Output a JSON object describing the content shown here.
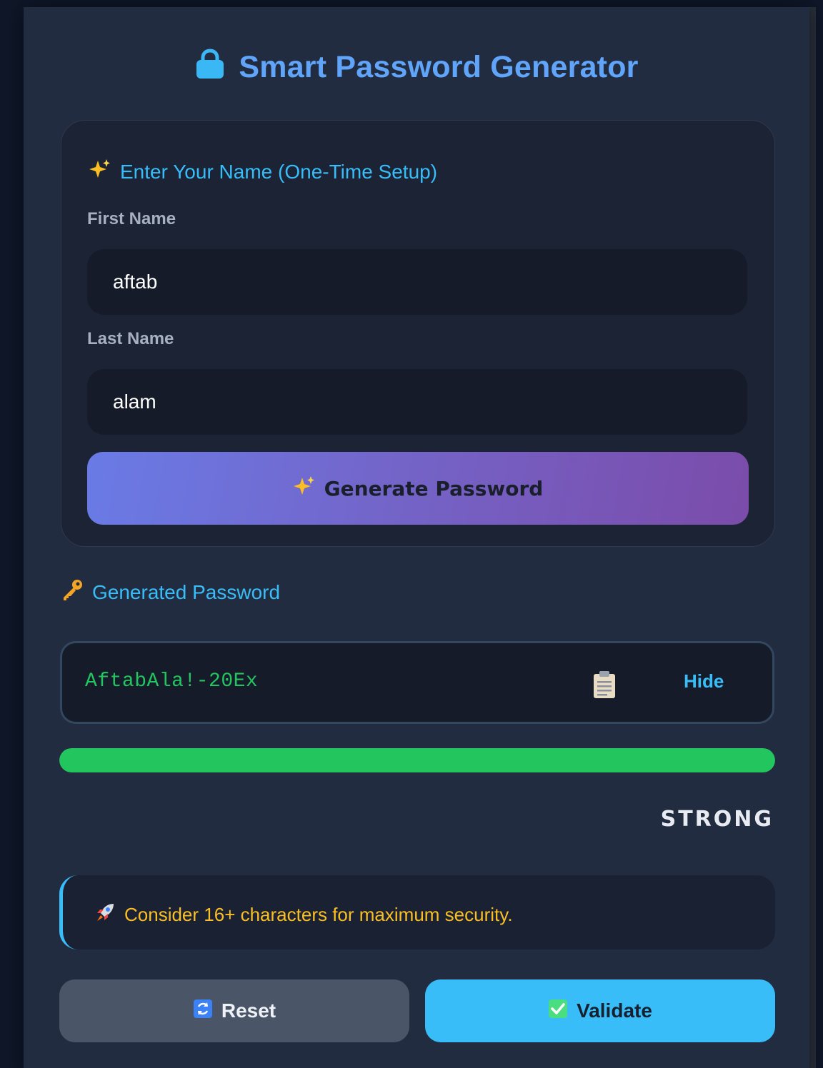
{
  "app": {
    "title": "Smart Password Generator",
    "title_icon": "lock-icon"
  },
  "setup": {
    "heading": "Enter Your Name (One-Time Setup)",
    "heading_icon": "sparkles-icon",
    "first_name_label": "First Name",
    "first_name_value": "aftab",
    "last_name_label": "Last Name",
    "last_name_value": "alam",
    "generate_button_label": "Generate Password",
    "generate_button_icon": "sparkles-icon"
  },
  "result": {
    "heading": "Generated Password",
    "heading_icon": "key-icon",
    "password": "AftabAla!-20Ex",
    "copy_icon": "clipboard-icon",
    "hide_label": "Hide",
    "strength_fill_percent": 100,
    "strength_label": "STRONG",
    "strength_color": "#22c55e"
  },
  "tip": {
    "icon": "rocket-icon",
    "text": "Consider 16+ characters for maximum security."
  },
  "actions": {
    "reset_label": "Reset",
    "reset_icon": "refresh-icon",
    "validate_label": "Validate",
    "validate_icon": "check-box-icon"
  },
  "colors": {
    "accent": "#38bdf8",
    "title": "#60a5fa",
    "success": "#22c55e",
    "tip": "#fbbf24"
  }
}
